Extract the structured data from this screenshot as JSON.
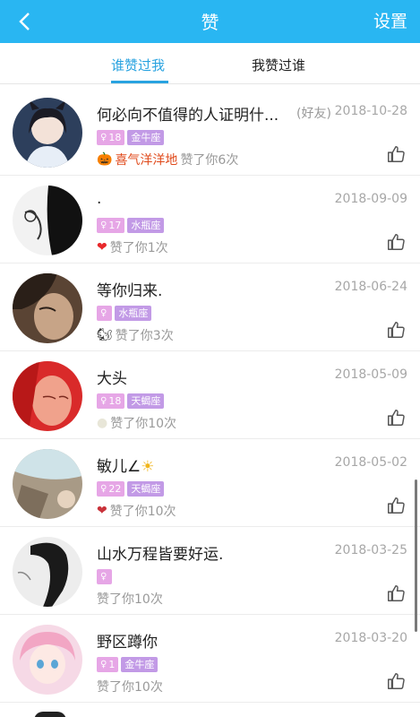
{
  "header": {
    "title": "赞",
    "settings_label": "设置"
  },
  "tabs": [
    {
      "label": "谁赞过我",
      "active": true
    },
    {
      "label": "我赞过谁",
      "active": false
    }
  ],
  "rows": [
    {
      "name": "何必向不值得的人证明什...",
      "friend_tag": "(好友)",
      "date": "2018-10-28",
      "age": "18",
      "zodiac": "金牛座",
      "gift_icon": "pumpkin-icon",
      "gift_name": "喜气洋洋地",
      "liked": "赞了你6次"
    },
    {
      "name": ".",
      "friend_tag": "",
      "date": "2018-09-09",
      "age": "17",
      "zodiac": "水瓶座",
      "gift_icon": "heart-icon",
      "gift_name": "",
      "liked": "赞了你1次"
    },
    {
      "name": "等你归来.",
      "friend_tag": "",
      "date": "2018-06-24",
      "age": "",
      "zodiac": "水瓶座",
      "gift_icon": "squirrel-icon",
      "gift_name": "",
      "liked": "赞了你3次"
    },
    {
      "name": "大头",
      "friend_tag": "",
      "date": "2018-05-09",
      "age": "18",
      "zodiac": "天蝎座",
      "gift_icon": "leaf-icon",
      "gift_name": "",
      "liked": "赞了你10次"
    },
    {
      "name": "敏儿∠",
      "friend_tag": "",
      "date": "2018-05-02",
      "age": "22",
      "zodiac": "天蝎座",
      "gift_icon": "heart-icon",
      "gift_name": "",
      "liked": "赞了你10次"
    },
    {
      "name": "山水万程皆要好运.",
      "friend_tag": "",
      "date": "2018-03-25",
      "age": "",
      "zodiac": "",
      "gift_icon": "",
      "gift_name": "",
      "liked": "赞了你10次"
    },
    {
      "name": "野区蹲你",
      "friend_tag": "",
      "date": "2018-03-20",
      "age": "1",
      "zodiac": "金牛座",
      "gift_icon": "",
      "gift_name": "",
      "liked": "赞了你10次"
    }
  ],
  "colors": {
    "header": "#29b6f2",
    "accent": "#29a3e0",
    "badge_age": "#e6a6e6",
    "badge_zodiac": "#c29ae6"
  }
}
